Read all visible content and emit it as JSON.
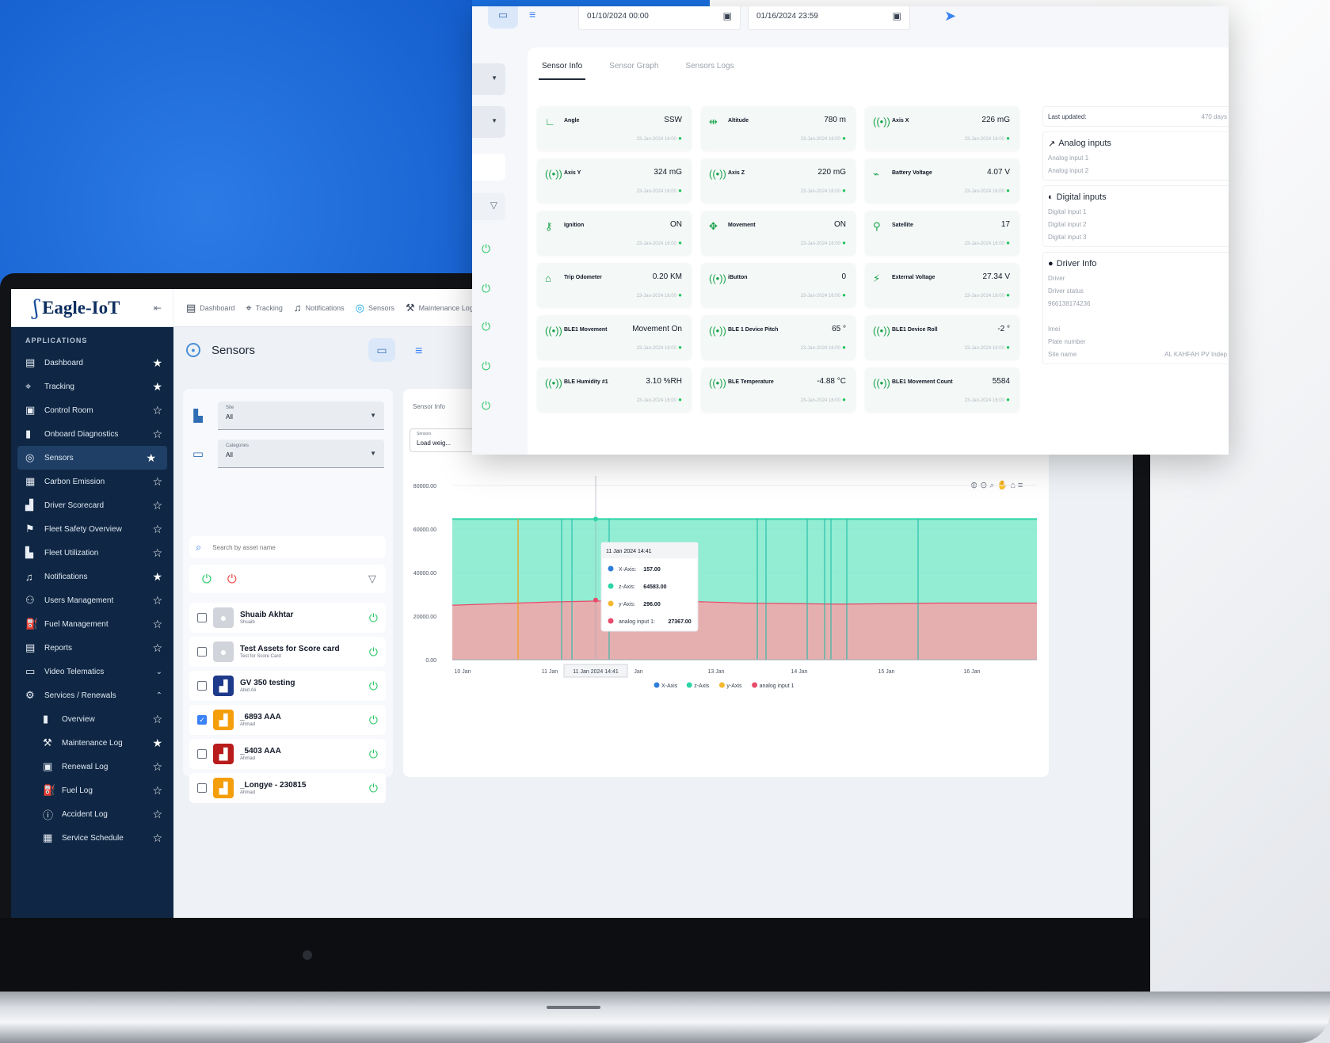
{
  "app": {
    "logo_text": "Eagle-IoT",
    "collapse_icon": "collapse-icon"
  },
  "top_nav": [
    {
      "label": "Dashboard",
      "icon": "dashboard-icon",
      "glyph": "▤"
    },
    {
      "label": "Tracking",
      "icon": "location-pin-icon",
      "glyph": "⌖"
    },
    {
      "label": "Notifications",
      "icon": "bell-icon",
      "glyph": "♫"
    },
    {
      "label": "Sensors",
      "icon": "sensor-icon",
      "glyph": "◎"
    },
    {
      "label": "Maintenance Log",
      "icon": "wrench-icon",
      "glyph": "⚒"
    }
  ],
  "sidebar": {
    "title": "APPLICATIONS",
    "items": [
      {
        "label": "Dashboard",
        "icon": "dashboard-icon",
        "glyph": "▤",
        "star": "★"
      },
      {
        "label": "Tracking",
        "icon": "location-pin-icon",
        "glyph": "⌖",
        "star": "★"
      },
      {
        "label": "Control Room",
        "icon": "control-room-icon",
        "glyph": "▣",
        "star": "☆"
      },
      {
        "label": "Onboard Diagnostics",
        "icon": "bar-chart-icon",
        "glyph": "▮",
        "star": "☆"
      },
      {
        "label": "Sensors",
        "icon": "sensor-icon",
        "glyph": "◎",
        "star": "★",
        "active": true
      },
      {
        "label": "Carbon Emission",
        "icon": "carbon-icon",
        "glyph": "▦",
        "star": "☆"
      },
      {
        "label": "Driver Scorecard",
        "icon": "scorecard-icon",
        "glyph": "▟",
        "star": "☆"
      },
      {
        "label": "Fleet Safety Overview",
        "icon": "safety-icon",
        "glyph": "⚑",
        "star": "☆"
      },
      {
        "label": "Fleet Utilization",
        "icon": "utilization-icon",
        "glyph": "▙",
        "star": "☆"
      },
      {
        "label": "Notifications",
        "icon": "bell-icon",
        "glyph": "♫",
        "star": "★"
      },
      {
        "label": "Users Management",
        "icon": "users-icon",
        "glyph": "⚇",
        "star": "☆"
      },
      {
        "label": "Fuel Management",
        "icon": "fuel-icon",
        "glyph": "⛽",
        "star": "☆"
      },
      {
        "label": "Reports",
        "icon": "reports-icon",
        "glyph": "▤",
        "star": "☆"
      },
      {
        "label": "Video Telematics",
        "icon": "video-icon",
        "glyph": "▭",
        "chev": "⌄"
      },
      {
        "label": "Services / Renewals",
        "icon": "services-icon",
        "glyph": "⚙",
        "chev": "⌃"
      },
      {
        "label": "Overview",
        "icon": "bar-chart-icon",
        "glyph": "▮",
        "star": "☆",
        "sub": true
      },
      {
        "label": "Maintenance Log",
        "icon": "wrench-icon",
        "glyph": "⚒",
        "star": "★",
        "sub": true
      },
      {
        "label": "Renewal Log",
        "icon": "renewal-icon",
        "glyph": "▣",
        "star": "☆",
        "sub": true
      },
      {
        "label": "Fuel Log",
        "icon": "fuel-icon",
        "glyph": "⛽",
        "star": "☆",
        "sub": true
      },
      {
        "label": "Accident Log",
        "icon": "accident-icon",
        "glyph": "ⓘ",
        "star": "☆",
        "sub": true
      },
      {
        "label": "Service Schedule",
        "icon": "calendar-icon",
        "glyph": "▦",
        "star": "☆",
        "sub": true
      }
    ]
  },
  "sensors_page": {
    "title": "Sensors",
    "site_select": {
      "caption": "Site",
      "value": "All"
    },
    "category_select": {
      "caption": "Categories",
      "value": "All"
    },
    "search_placeholder": "Search by asset name",
    "assets": [
      {
        "name": "Shuaib Akhtar",
        "sub": "Shuaib",
        "checked": false,
        "avatar": "person"
      },
      {
        "name": "Test Assets for Score card",
        "sub": "Test for Score Card",
        "checked": false,
        "avatar": "person"
      },
      {
        "name": "GV 350 testing",
        "sub": "Abid Ali",
        "checked": false,
        "avatar": "blue"
      },
      {
        "name": "_6893 AAA",
        "sub": "Ahmad",
        "checked": true,
        "avatar": "truck"
      },
      {
        "name": "_5403 AAA",
        "sub": "Ahmad",
        "checked": false,
        "avatar": "red"
      },
      {
        "name": "_Longye - 230815",
        "sub": "Ahmad",
        "checked": false,
        "avatar": "truck"
      }
    ],
    "chart_tab": "Sensor Info",
    "sensor_select": {
      "caption": "Sensors",
      "value": "Load weig..."
    }
  },
  "chart_data": {
    "type": "area",
    "y_ticks": [
      "80000.00",
      "60000.00",
      "40000.00",
      "20000.00",
      "0.00"
    ],
    "ylim": [
      0,
      80000
    ],
    "x_ticks": [
      "10 Jan",
      "11 Jan",
      "Jan",
      "13 Jan",
      "14 Jan",
      "15 Jan",
      "16 Jan"
    ],
    "x_highlight": "11 Jan 2024 14:41",
    "series": [
      {
        "name": "X-Axis",
        "color": "#2f7ed8",
        "values": [
          157,
          157,
          157,
          157,
          157,
          157,
          157
        ]
      },
      {
        "name": "z-Axis",
        "color": "#2dd4a7",
        "values": [
          64583,
          64583,
          64583,
          64583,
          64583,
          64583,
          64583
        ]
      },
      {
        "name": "y-Axis",
        "color": "#f5b82e",
        "values": [
          296,
          296,
          296,
          296,
          296,
          296,
          296
        ]
      },
      {
        "name": "analog input 1",
        "color": "#e84a6a",
        "values": [
          25000,
          26500,
          27367,
          26000,
          25500,
          26000,
          26000
        ]
      }
    ],
    "tooltip": {
      "title": "11 Jan 2024 14:41",
      "rows": [
        {
          "label": "X-Axis:",
          "value": "157.00",
          "color": "#2f7ed8"
        },
        {
          "label": "z-Axis:",
          "value": "64583.00",
          "color": "#2dd4a7"
        },
        {
          "label": "y-Axis:",
          "value": "296.00",
          "color": "#f5b82e"
        },
        {
          "label": "analog input 1:",
          "value": "27367.00",
          "color": "#e84a6a"
        }
      ]
    }
  },
  "floating": {
    "date_from": "01/10/2024 00:00",
    "date_to": "01/16/2024 23:59",
    "tabs": [
      "Sensor Info",
      "Sensor Graph",
      "Sensors Logs"
    ],
    "tiles": [
      {
        "name": "Angle",
        "value": "SSW",
        "ts": "23-Jan-2024 16:00",
        "glyph": "∟"
      },
      {
        "name": "Altitude",
        "value": "780 m",
        "ts": "23-Jan-2024 16:00",
        "glyph": "⇹"
      },
      {
        "name": "Axis X",
        "value": "226 mG",
        "ts": "23-Jan-2024 16:00",
        "glyph": "((•))"
      },
      {
        "name": "Axis Y",
        "value": "324 mG",
        "ts": "23-Jan-2024 16:00",
        "glyph": "((•))"
      },
      {
        "name": "Axis Z",
        "value": "220 mG",
        "ts": "23-Jan-2024 16:00",
        "glyph": "((•))"
      },
      {
        "name": "Battery Voltage",
        "value": "4.07 V",
        "ts": "23-Jan-2024 16:00",
        "glyph": "⌁"
      },
      {
        "name": "Ignition",
        "value": "ON",
        "ts": "23-Jan-2024 16:00",
        "glyph": "⚷"
      },
      {
        "name": "Movement",
        "value": "ON",
        "ts": "23-Jan-2024 16:00",
        "glyph": "✥"
      },
      {
        "name": "Satellite",
        "value": "17",
        "ts": "23-Jan-2024 16:00",
        "glyph": "⚲"
      },
      {
        "name": "Trip Odometer",
        "value": "0.20 KM",
        "ts": "23-Jan-2024 16:00",
        "glyph": "⌂"
      },
      {
        "name": "iButton",
        "value": "0",
        "ts": "23-Jan-2024 16:00",
        "glyph": "((•))"
      },
      {
        "name": "External Voltage",
        "value": "27.34 V",
        "ts": "23-Jan-2024 16:00",
        "glyph": "⚡"
      },
      {
        "name": "BLE1 Movement",
        "value": "Movement On",
        "ts": "23-Jan-2024 16:00",
        "glyph": "((•))"
      },
      {
        "name": "BLE 1 Device Pitch",
        "value": "65 °",
        "ts": "23-Jan-2024 16:00",
        "glyph": "((•))"
      },
      {
        "name": "BLE1 Device Roll",
        "value": "-2 °",
        "ts": "23-Jan-2024 16:00",
        "glyph": "((•))"
      },
      {
        "name": "BLE Humidity #1",
        "value": "3.10 %RH",
        "ts": "23-Jan-2024 16:00",
        "glyph": "((•))"
      },
      {
        "name": "BLE Temperature",
        "value": "-4.88 °C",
        "ts": "23-Jan-2024 16:00",
        "glyph": "((•))"
      },
      {
        "name": "BLE1 Movement Count",
        "value": "5584",
        "ts": "23-Jan-2024 16:00",
        "glyph": "((•))"
      }
    ],
    "info": {
      "last_updated_label": "Last updated:",
      "last_updated_value": "470 days",
      "analog_title": "Analog inputs",
      "analog": [
        "Analog input 1",
        "Analog input 2"
      ],
      "digital_title": "Digital inputs",
      "digital": [
        "Digital input 1",
        "Digital input 2",
        "Digital input 3"
      ],
      "driver_title": "Driver Info",
      "driver_lines": [
        "Driver",
        "Driver status",
        "966138174236",
        "",
        "Imei",
        "Plate number"
      ],
      "site_label": "Site name",
      "site_value": "AL KAHFAH PV Indep"
    }
  }
}
